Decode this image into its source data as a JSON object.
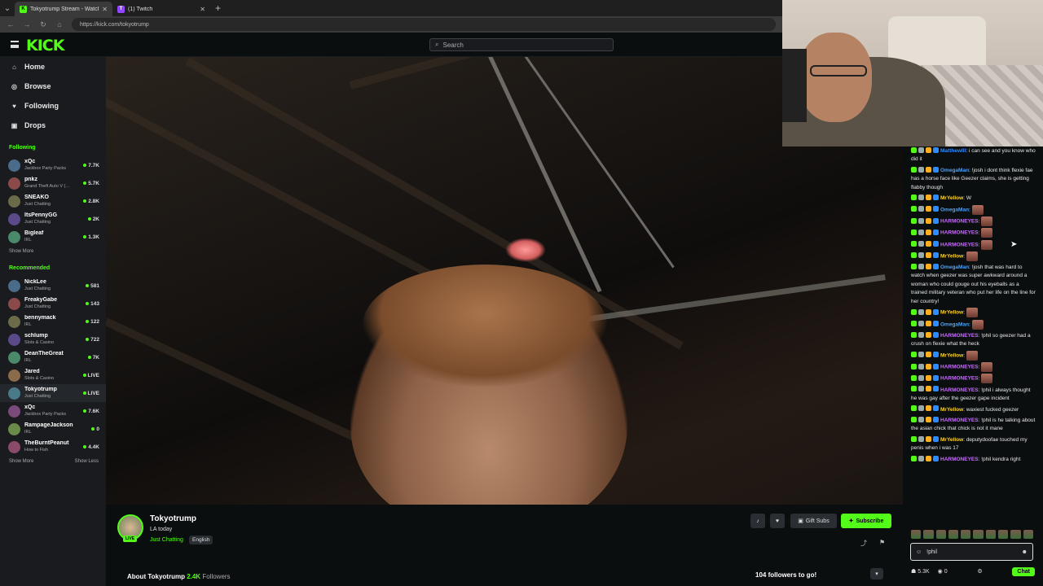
{
  "browser": {
    "tabs": [
      {
        "title": "Tokyotrump Stream - Watch L",
        "icon": "K",
        "active": true
      },
      {
        "title": "(1) Twitch",
        "icon": "T",
        "active": false
      }
    ],
    "url": "https://kick.com/tokyotrump"
  },
  "header": {
    "logo": "KICK",
    "search_placeholder": "Search"
  },
  "nav": [
    {
      "label": "Home",
      "icon": "home-icon"
    },
    {
      "label": "Browse",
      "icon": "compass-icon"
    },
    {
      "label": "Following",
      "icon": "heart-icon"
    },
    {
      "label": "Drops",
      "icon": "gift-icon"
    }
  ],
  "following": {
    "heading": "Following",
    "channels": [
      {
        "name": "xQc",
        "category": "Jackbox Party Packs",
        "viewers": "7.7K"
      },
      {
        "name": "pnkz",
        "category": "Grand Theft Auto V (…",
        "viewers": "5.7K"
      },
      {
        "name": "SNEAKO",
        "category": "Just Chatting",
        "viewers": "2.8K"
      },
      {
        "name": "ItsPennyGG",
        "category": "Just Chatting",
        "viewers": "2K"
      },
      {
        "name": "Bigleaf",
        "category": "IRL",
        "viewers": "1.3K"
      }
    ],
    "show_more": "Show More"
  },
  "recommended": {
    "heading": "Recommended",
    "channels": [
      {
        "name": "NickLee",
        "category": "Just Chatting",
        "viewers": "581"
      },
      {
        "name": "FreakyGabe",
        "category": "Just Chatting",
        "viewers": "143"
      },
      {
        "name": "bennymack",
        "category": "IRL",
        "viewers": "122"
      },
      {
        "name": "schlump",
        "category": "Slots & Casino",
        "viewers": "722"
      },
      {
        "name": "DeanTheGreat",
        "category": "IRL",
        "viewers": "7K"
      },
      {
        "name": "Jared",
        "category": "Slots & Casino",
        "viewers": "LIVE"
      },
      {
        "name": "Tokyotrump",
        "category": "Just Chatting",
        "viewers": "LIVE"
      },
      {
        "name": "xQc",
        "category": "Jackbox Party Packs",
        "viewers": "7.6K"
      },
      {
        "name": "RampageJackson",
        "category": "IRL",
        "viewers": "0"
      },
      {
        "name": "TheBurntPeanut",
        "category": "How to Fish",
        "viewers": "4.4K"
      }
    ],
    "show_more": "Show More",
    "show_less": "Show Less"
  },
  "stream": {
    "streamer": "Tokyotrump",
    "title": "LA today",
    "category": "Just Chatting",
    "language": "English",
    "badge": "LIVE",
    "gift_subs": "Gift Subs",
    "subscribe": "Subscribe",
    "about": "About Tokyotrump",
    "followers": "2.4K",
    "followers_label": "Followers",
    "goal": "104 followers to go!"
  },
  "chat": {
    "messages": [
      {
        "user": "Matthewlll",
        "color": "#2f8cff",
        "text": "i can see and you know who did it"
      },
      {
        "user": "OmegaMan",
        "color": "#4aa3ff",
        "text": "!josh i dont think flexie fae has a horse face like Geezer claims, she is getting flabby though"
      },
      {
        "user": "MrYellow",
        "color": "#ffd42a",
        "text": "W"
      },
      {
        "user": "OmegaMan",
        "color": "#4aa3ff",
        "text": ""
      },
      {
        "user": "HARMONEYES",
        "color": "#c86cff",
        "text": ""
      },
      {
        "user": "HARMONEYES",
        "color": "#c86cff",
        "text": ""
      },
      {
        "user": "HARMONEYES",
        "color": "#c86cff",
        "text": ""
      },
      {
        "user": "MrYellow",
        "color": "#ffd42a",
        "text": ""
      },
      {
        "user": "OmegaMan",
        "color": "#4aa3ff",
        "text": "!josh that was hard to watch when geezer was super awkward around a woman who could gouge out his eyeballs as a trained military veteran who put her life on the line for her country!"
      },
      {
        "user": "MrYellow",
        "color": "#ffd42a",
        "text": ""
      },
      {
        "user": "OmegaMan",
        "color": "#4aa3ff",
        "text": ""
      },
      {
        "user": "HARMONEYES",
        "color": "#c86cff",
        "text": "!phil so geezer had a crush on flexie what the heck"
      },
      {
        "user": "MrYellow",
        "color": "#ffd42a",
        "text": ""
      },
      {
        "user": "HARMONEYES",
        "color": "#c86cff",
        "text": ""
      },
      {
        "user": "HARMONEYES",
        "color": "#c86cff",
        "text": ""
      },
      {
        "user": "HARMONEYES",
        "color": "#c86cff",
        "text": "!phil i always thought he was gay after the geezer gape incident"
      },
      {
        "user": "MrYellow",
        "color": "#ffd42a",
        "text": "waxiest fucked geezer"
      },
      {
        "user": "HARMONEYES",
        "color": "#c86cff",
        "text": "!phil is he talking about the asian chick that chick is not it mane"
      },
      {
        "user": "MrYellow",
        "color": "#ffd42a",
        "text": "deputydoofae touched my penis when i was 17"
      },
      {
        "user": "HARMONEYES",
        "color": "#c86cff",
        "text": "!phil kendra right"
      }
    ],
    "input_value": "!phil",
    "viewer_count": "5.3K",
    "points": "0",
    "chat_button": "Chat"
  }
}
